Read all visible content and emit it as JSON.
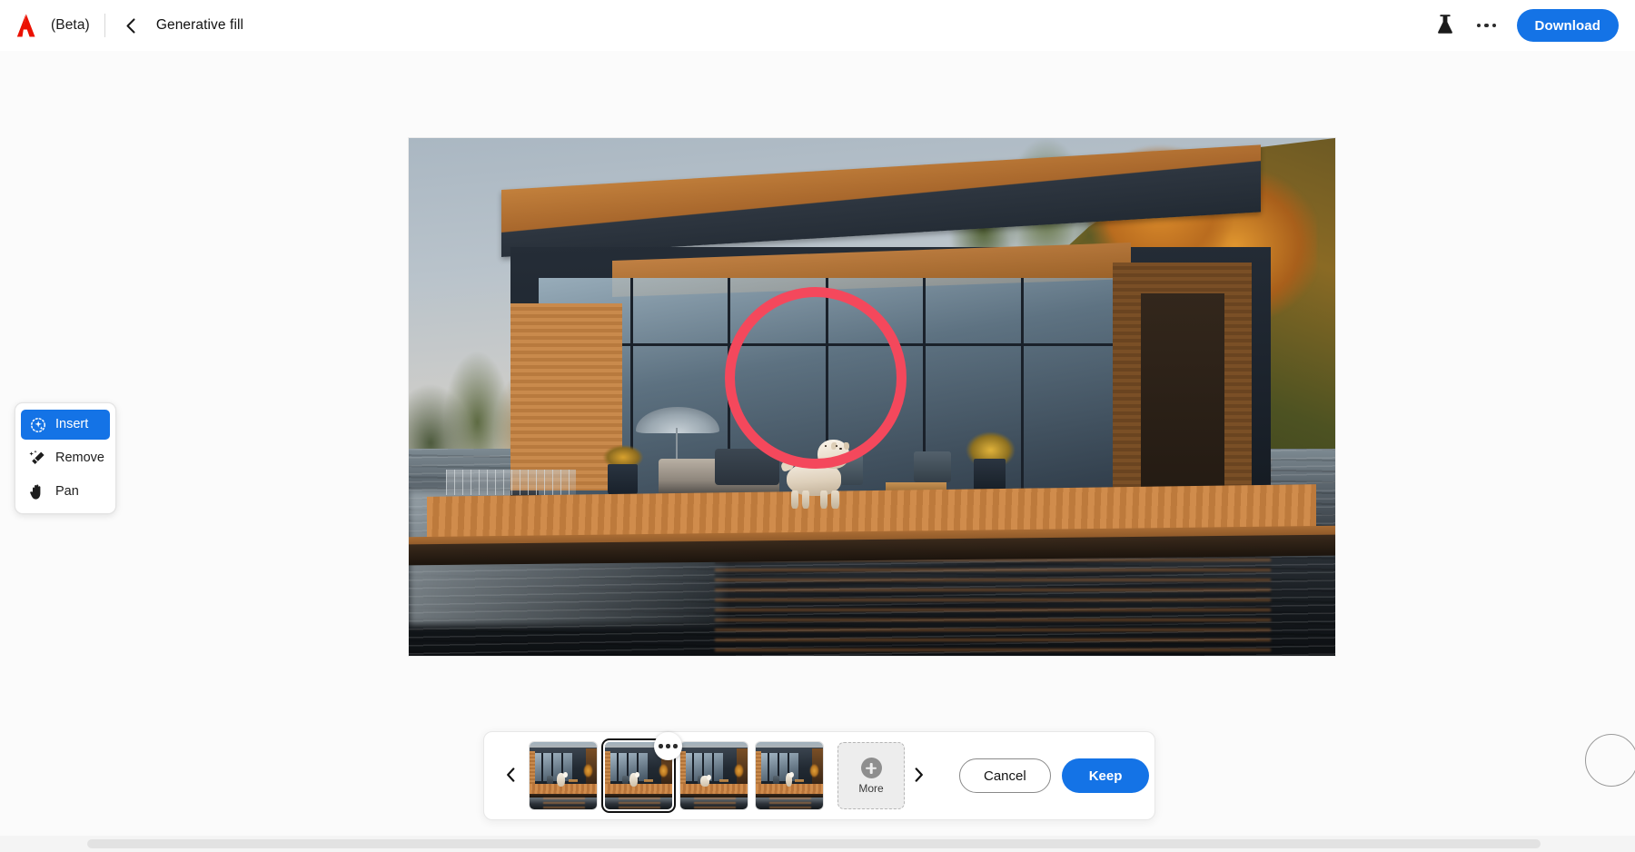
{
  "header": {
    "brand_icon": "adobe-logo",
    "beta_label": "(Beta)",
    "back_icon": "chevron-left-icon",
    "title": "Generative fill",
    "beaker_icon": "beaker-icon",
    "more_icon": "more-horizontal-icon",
    "download_label": "Download",
    "accent_color": "#1473e6",
    "brand_color": "#eb1000"
  },
  "tool_panel": {
    "items": [
      {
        "label": "Insert",
        "icon": "sparkle-circle-icon",
        "selected": true
      },
      {
        "label": "Remove",
        "icon": "magic-eraser-icon",
        "selected": false
      },
      {
        "label": "Pan",
        "icon": "hand-icon",
        "selected": false
      }
    ]
  },
  "canvas": {
    "selection_ring_color": "#f4485c",
    "brush_cursor_icon": "brush-cursor-circle"
  },
  "filmstrip": {
    "prev_icon": "chevron-left-icon",
    "next_icon": "chevron-right-icon",
    "variations": [
      {
        "name": "variation-1",
        "selected": false
      },
      {
        "name": "variation-2",
        "selected": true,
        "badge_icon": "more-horizontal-icon"
      },
      {
        "name": "variation-3",
        "selected": false
      },
      {
        "name": "variation-4",
        "selected": false
      }
    ],
    "more": {
      "label": "More",
      "icon": "plus-circle-icon"
    },
    "cancel_label": "Cancel",
    "keep_label": "Keep"
  }
}
